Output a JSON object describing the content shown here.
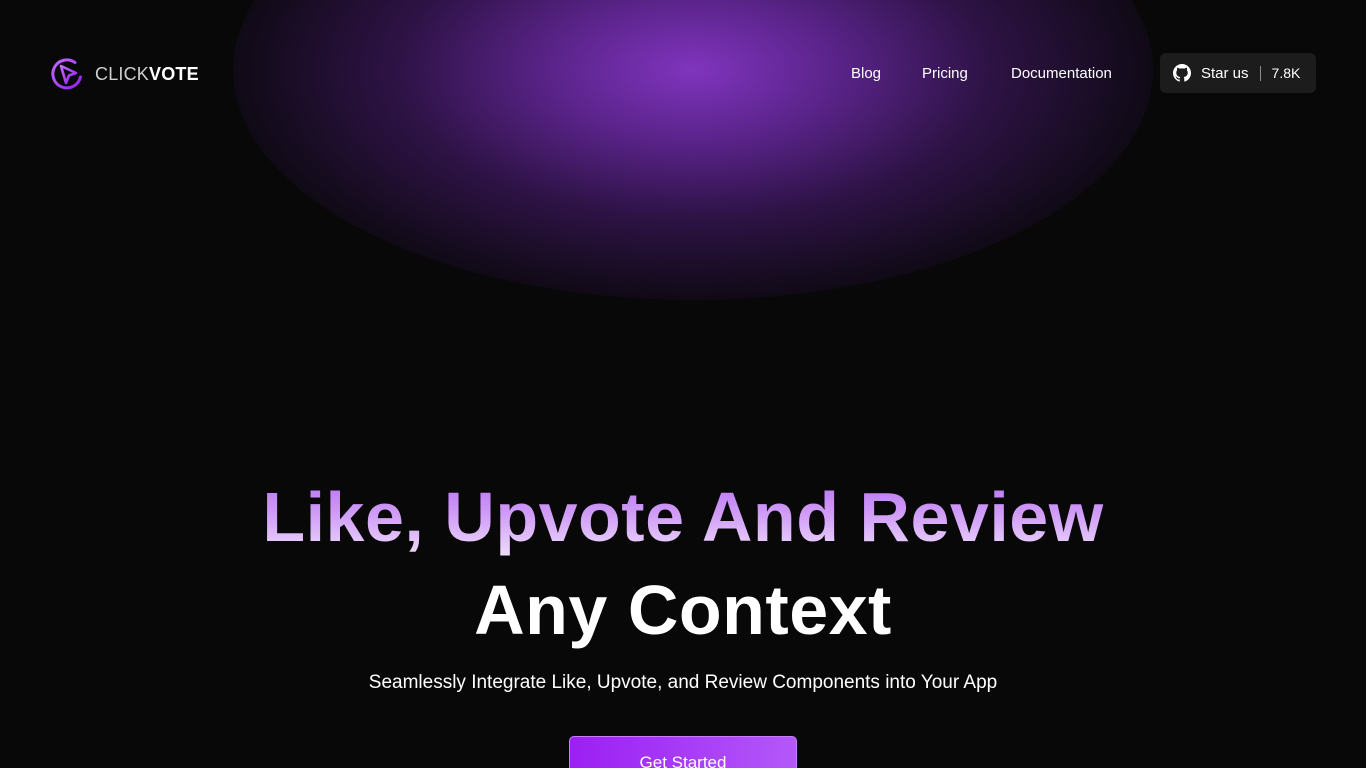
{
  "brand": {
    "name_part1": "CLICK",
    "name_part2": "VOTE",
    "accent_color": "#a33af5"
  },
  "nav": {
    "items": [
      {
        "label": "Blog"
      },
      {
        "label": "Pricing"
      },
      {
        "label": "Documentation"
      }
    ]
  },
  "github": {
    "icon": "github-icon",
    "label": "Star us",
    "count": "7.8K"
  },
  "hero": {
    "title_line1": "Like, Upvote And Review",
    "title_line2": "Any Context",
    "subtitle": "Seamlessly Integrate Like, Upvote, and Review Components into Your App",
    "cta_label": "Get Started",
    "gradient_colors": [
      "#b66cf2",
      "#f1e2fd"
    ]
  },
  "theme": {
    "background": "#080808",
    "glow_color": "#8034be"
  }
}
